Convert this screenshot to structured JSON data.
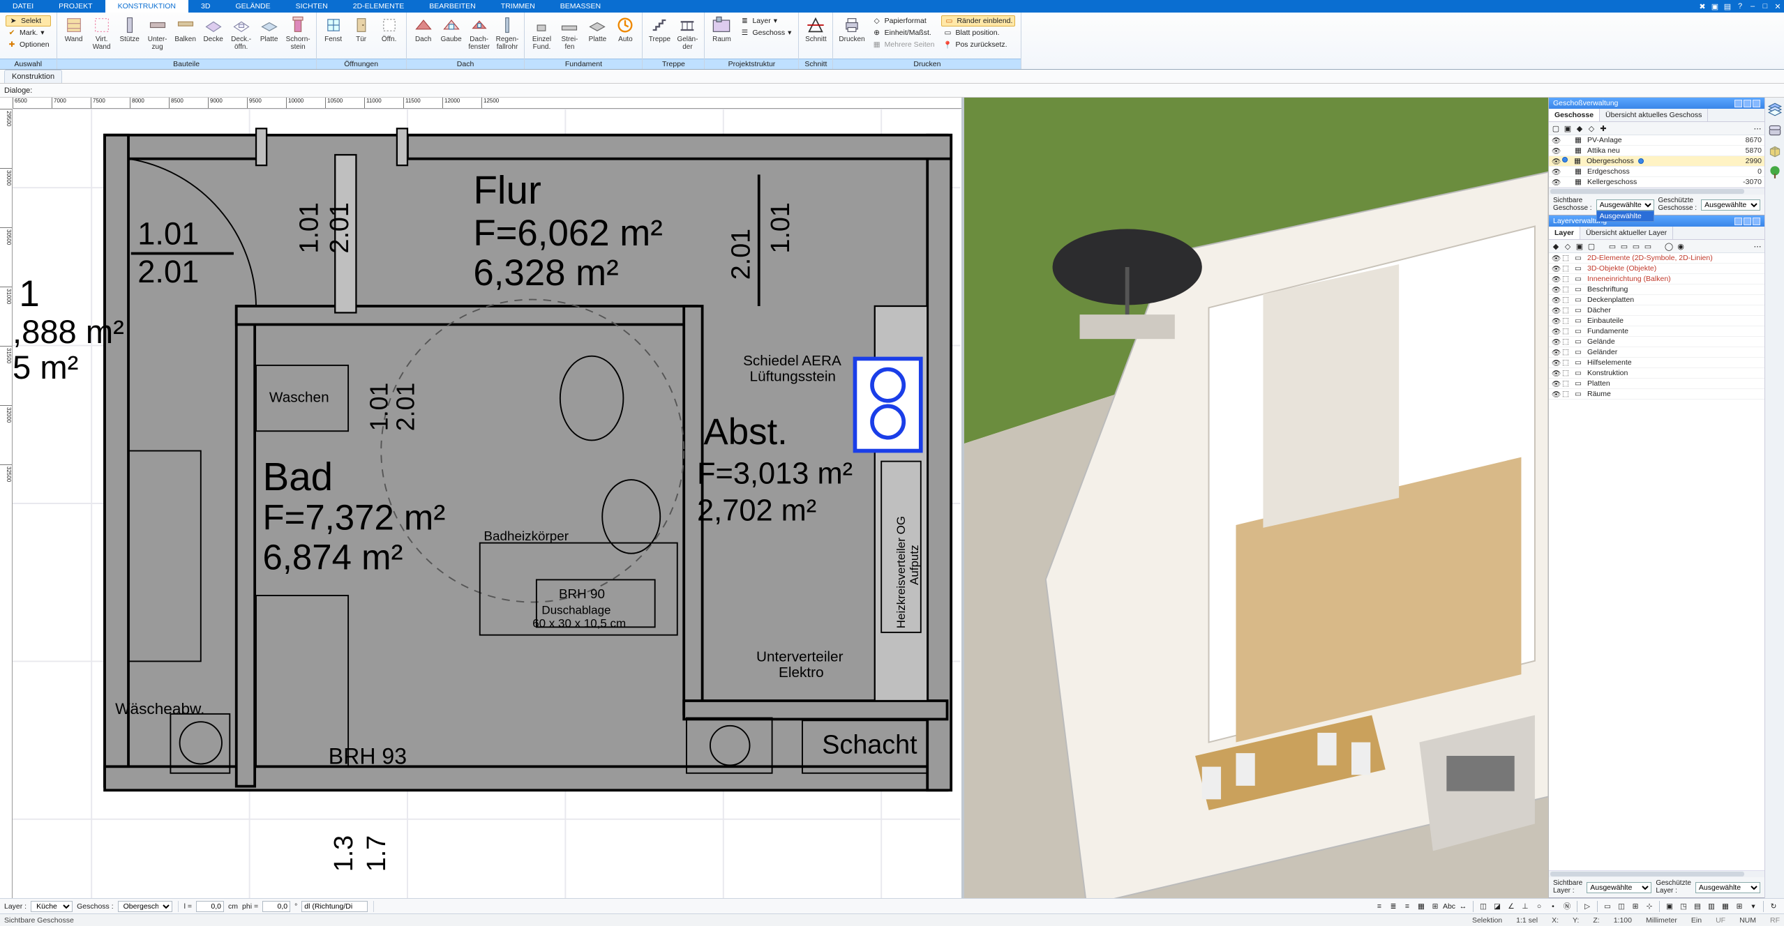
{
  "menu": {
    "tabs": [
      "DATEI",
      "PROJEKT",
      "KONSTRUKTION",
      "3D",
      "GELÄNDE",
      "SICHTEN",
      "2D-ELEMENTE",
      "BEARBEITEN",
      "TRIMMEN",
      "BEMASSEN"
    ],
    "active": "KONSTRUKTION"
  },
  "ribbon": {
    "auswahl": {
      "label": "Auswahl",
      "select": "Selekt",
      "mark": "Mark.",
      "optionen": "Optionen"
    },
    "bauteile": {
      "label": "Bauteile",
      "items": [
        {
          "id": "wand",
          "label": "Wand"
        },
        {
          "id": "virt-wand",
          "label": "Virt.\nWand"
        },
        {
          "id": "stuetze",
          "label": "Stütze"
        },
        {
          "id": "unterzug",
          "label": "Unter-\nzug"
        },
        {
          "id": "balken",
          "label": "Balken"
        },
        {
          "id": "decke",
          "label": "Decke"
        },
        {
          "id": "deckoeffn",
          "label": "Deck.-\nöffn."
        },
        {
          "id": "platte",
          "label": "Platte"
        },
        {
          "id": "schornstein",
          "label": "Schorn-\nstein"
        }
      ]
    },
    "oeffnungen": {
      "label": "Öffnungen",
      "items": [
        {
          "id": "fenst",
          "label": "Fenst"
        },
        {
          "id": "tuer",
          "label": "Tür"
        },
        {
          "id": "oeffn",
          "label": "Öffn."
        }
      ]
    },
    "dach": {
      "label": "Dach",
      "items": [
        {
          "id": "dach",
          "label": "Dach"
        },
        {
          "id": "gaube",
          "label": "Gaube"
        },
        {
          "id": "dachfenster",
          "label": "Dach-\nfenster"
        },
        {
          "id": "regenfallrohr",
          "label": "Regen-\nfallrohr"
        }
      ]
    },
    "fundament": {
      "label": "Fundament",
      "items": [
        {
          "id": "einzel",
          "label": "Einzel\nFund."
        },
        {
          "id": "streifen",
          "label": "Strei-\nfen"
        },
        {
          "id": "platte2",
          "label": "Platte"
        },
        {
          "id": "auto",
          "label": "Auto"
        }
      ]
    },
    "treppe": {
      "label": "Treppe",
      "items": [
        {
          "id": "treppe",
          "label": "Treppe"
        },
        {
          "id": "gelaender",
          "label": "Gelän-\nder"
        }
      ]
    },
    "projektstruktur": {
      "label": "Projektstruktur",
      "items": [
        {
          "id": "raum",
          "label": "Raum"
        }
      ],
      "side": [
        {
          "id": "layer",
          "label": "Layer"
        },
        {
          "id": "geschoss",
          "label": "Geschoss"
        }
      ]
    },
    "schnitt": {
      "label": "Schnitt",
      "items": [
        {
          "id": "schnitt",
          "label": "Schnitt"
        }
      ]
    },
    "drucken": {
      "label": "Drucken",
      "items": [
        {
          "id": "drucken",
          "label": "Drucken"
        }
      ],
      "side": [
        {
          "id": "papierformat",
          "label": "Papierformat"
        },
        {
          "id": "einheitmassst",
          "label": "Einheit/Maßst."
        },
        {
          "id": "mehrereseiten",
          "label": "Mehrere Seiten"
        }
      ],
      "side2": [
        {
          "id": "raender",
          "label": "Ränder einblend.",
          "hl": true
        },
        {
          "id": "blattpos",
          "label": "Blatt position."
        },
        {
          "id": "posreset",
          "label": "Pos zurücksetz."
        }
      ]
    }
  },
  "subheader": {
    "tab": "Konstruktion",
    "dialoge": "Dialoge:"
  },
  "geschoss_panel": {
    "title": "Geschoßverwaltung",
    "tabs": [
      "Geschosse",
      "Übersicht aktuelles Geschoss"
    ],
    "items": [
      {
        "name": "PV-Anlage",
        "val": "8670"
      },
      {
        "name": "Attika neu",
        "val": "5870"
      },
      {
        "name": "Obergeschoss",
        "val": "2990",
        "sel": true,
        "active": true
      },
      {
        "name": "Erdgeschoss",
        "val": "0"
      },
      {
        "name": "Kellergeschoss",
        "val": "-3070"
      }
    ],
    "sichtbare_label": "Sichtbare\nGeschosse :",
    "geschuetzte_label": "Geschützte\nGeschosse :",
    "sichtbare_value": "Ausgewählte",
    "geschuetzte_value": "Ausgewählte",
    "dd_option": "Ausgewählte"
  },
  "layer_panel": {
    "title": "Layerverwaltung",
    "tabs": [
      "Layer",
      "Übersicht aktueller Layer"
    ],
    "items": [
      {
        "name": "2D-Elemente (2D-Symbole, 2D-Linien)",
        "red": true
      },
      {
        "name": "3D-Objekte (Objekte)",
        "red": true
      },
      {
        "name": "Inneneinrichtung (Balken)",
        "red": true
      },
      {
        "name": "Beschriftung"
      },
      {
        "name": "Deckenplatten"
      },
      {
        "name": "Dächer"
      },
      {
        "name": "Einbauteile"
      },
      {
        "name": "Fundamente"
      },
      {
        "name": "Gelände"
      },
      {
        "name": "Geländer"
      },
      {
        "name": "Hilfselemente"
      },
      {
        "name": "Konstruktion"
      },
      {
        "name": "Platten"
      },
      {
        "name": "Räume"
      }
    ],
    "sichtbare_label": "Sichtbare\nLayer :",
    "geschuetzte_label": "Geschützte\nLayer :",
    "sichtbare_value": "Ausgewählte",
    "geschuetzte_value": "Ausgewählte"
  },
  "ruler": {
    "h": [
      "6500",
      "7000",
      "7500",
      "8000",
      "8500",
      "9000",
      "9500",
      "10000",
      "10500",
      "11000",
      "11500",
      "12000",
      "12500"
    ],
    "v": [
      "30500",
      "31000",
      "31500",
      "32000",
      "32500",
      "30000",
      "29500"
    ]
  },
  "plan": {
    "flur": {
      "name": "Flur",
      "f": "F=6,062 m²",
      "a": "6,328 m²"
    },
    "bad": {
      "name": "Bad",
      "f": "F=7,372 m²",
      "a": "6,874 m²"
    },
    "abst": {
      "name": "Abst.",
      "f": "F=3,013 m²",
      "a": "2,702 m²"
    },
    "left": {
      "line1": "1",
      "line2": ",888 m²",
      "line3": "5 m²"
    },
    "dim_topright": {
      "a": "1.01",
      "b": "2.01"
    },
    "dim_topleft": {
      "a": "1.01",
      "b": "2.01"
    },
    "dim_midleft": {
      "a": "1.01",
      "b": "2.01"
    },
    "dim_farleft": {
      "a": "1.01",
      "b": "2.01"
    },
    "dim_bottom": {
      "a": "1.3",
      "b": "1.7"
    },
    "schiedel": "Schiedel AERA\nLüftungsstein",
    "heizkreisverteiler": "Heizkreisverteiler OG\nAufputz",
    "unterverteiler": "Unterverteiler\nElektro",
    "waschen": "Waschen",
    "waescheabw": "Wäscheabw.",
    "brh93": "BRH 93",
    "brh90": "BRH 90",
    "duschablage": "Duschablage\n60 x 30 x 10,5 cm",
    "badheizkoerper": "Badheizkörper",
    "schacht": "Schacht"
  },
  "formbar": {
    "layer_label": "Layer :",
    "layer_value": "Küche",
    "geschoss_label": "Geschoss :",
    "geschoss_value": "Obergescho",
    "l_label": "l =",
    "l_value": "0,0",
    "l_unit": "cm",
    "phi_label": "phi =",
    "phi_value": "0,0",
    "phi_unit": "°",
    "dl_label": "dl (Richtung/Di"
  },
  "status": {
    "left": "Sichtbare Geschosse",
    "selektion": "Selektion",
    "ratio": "1:1 sel",
    "x": "X:",
    "y": "Y:",
    "z": "Z:",
    "scale": "1:100",
    "unit": "Millimeter",
    "ein": "Ein",
    "uf": "UF",
    "num": "NUM",
    "rf": "RF"
  }
}
